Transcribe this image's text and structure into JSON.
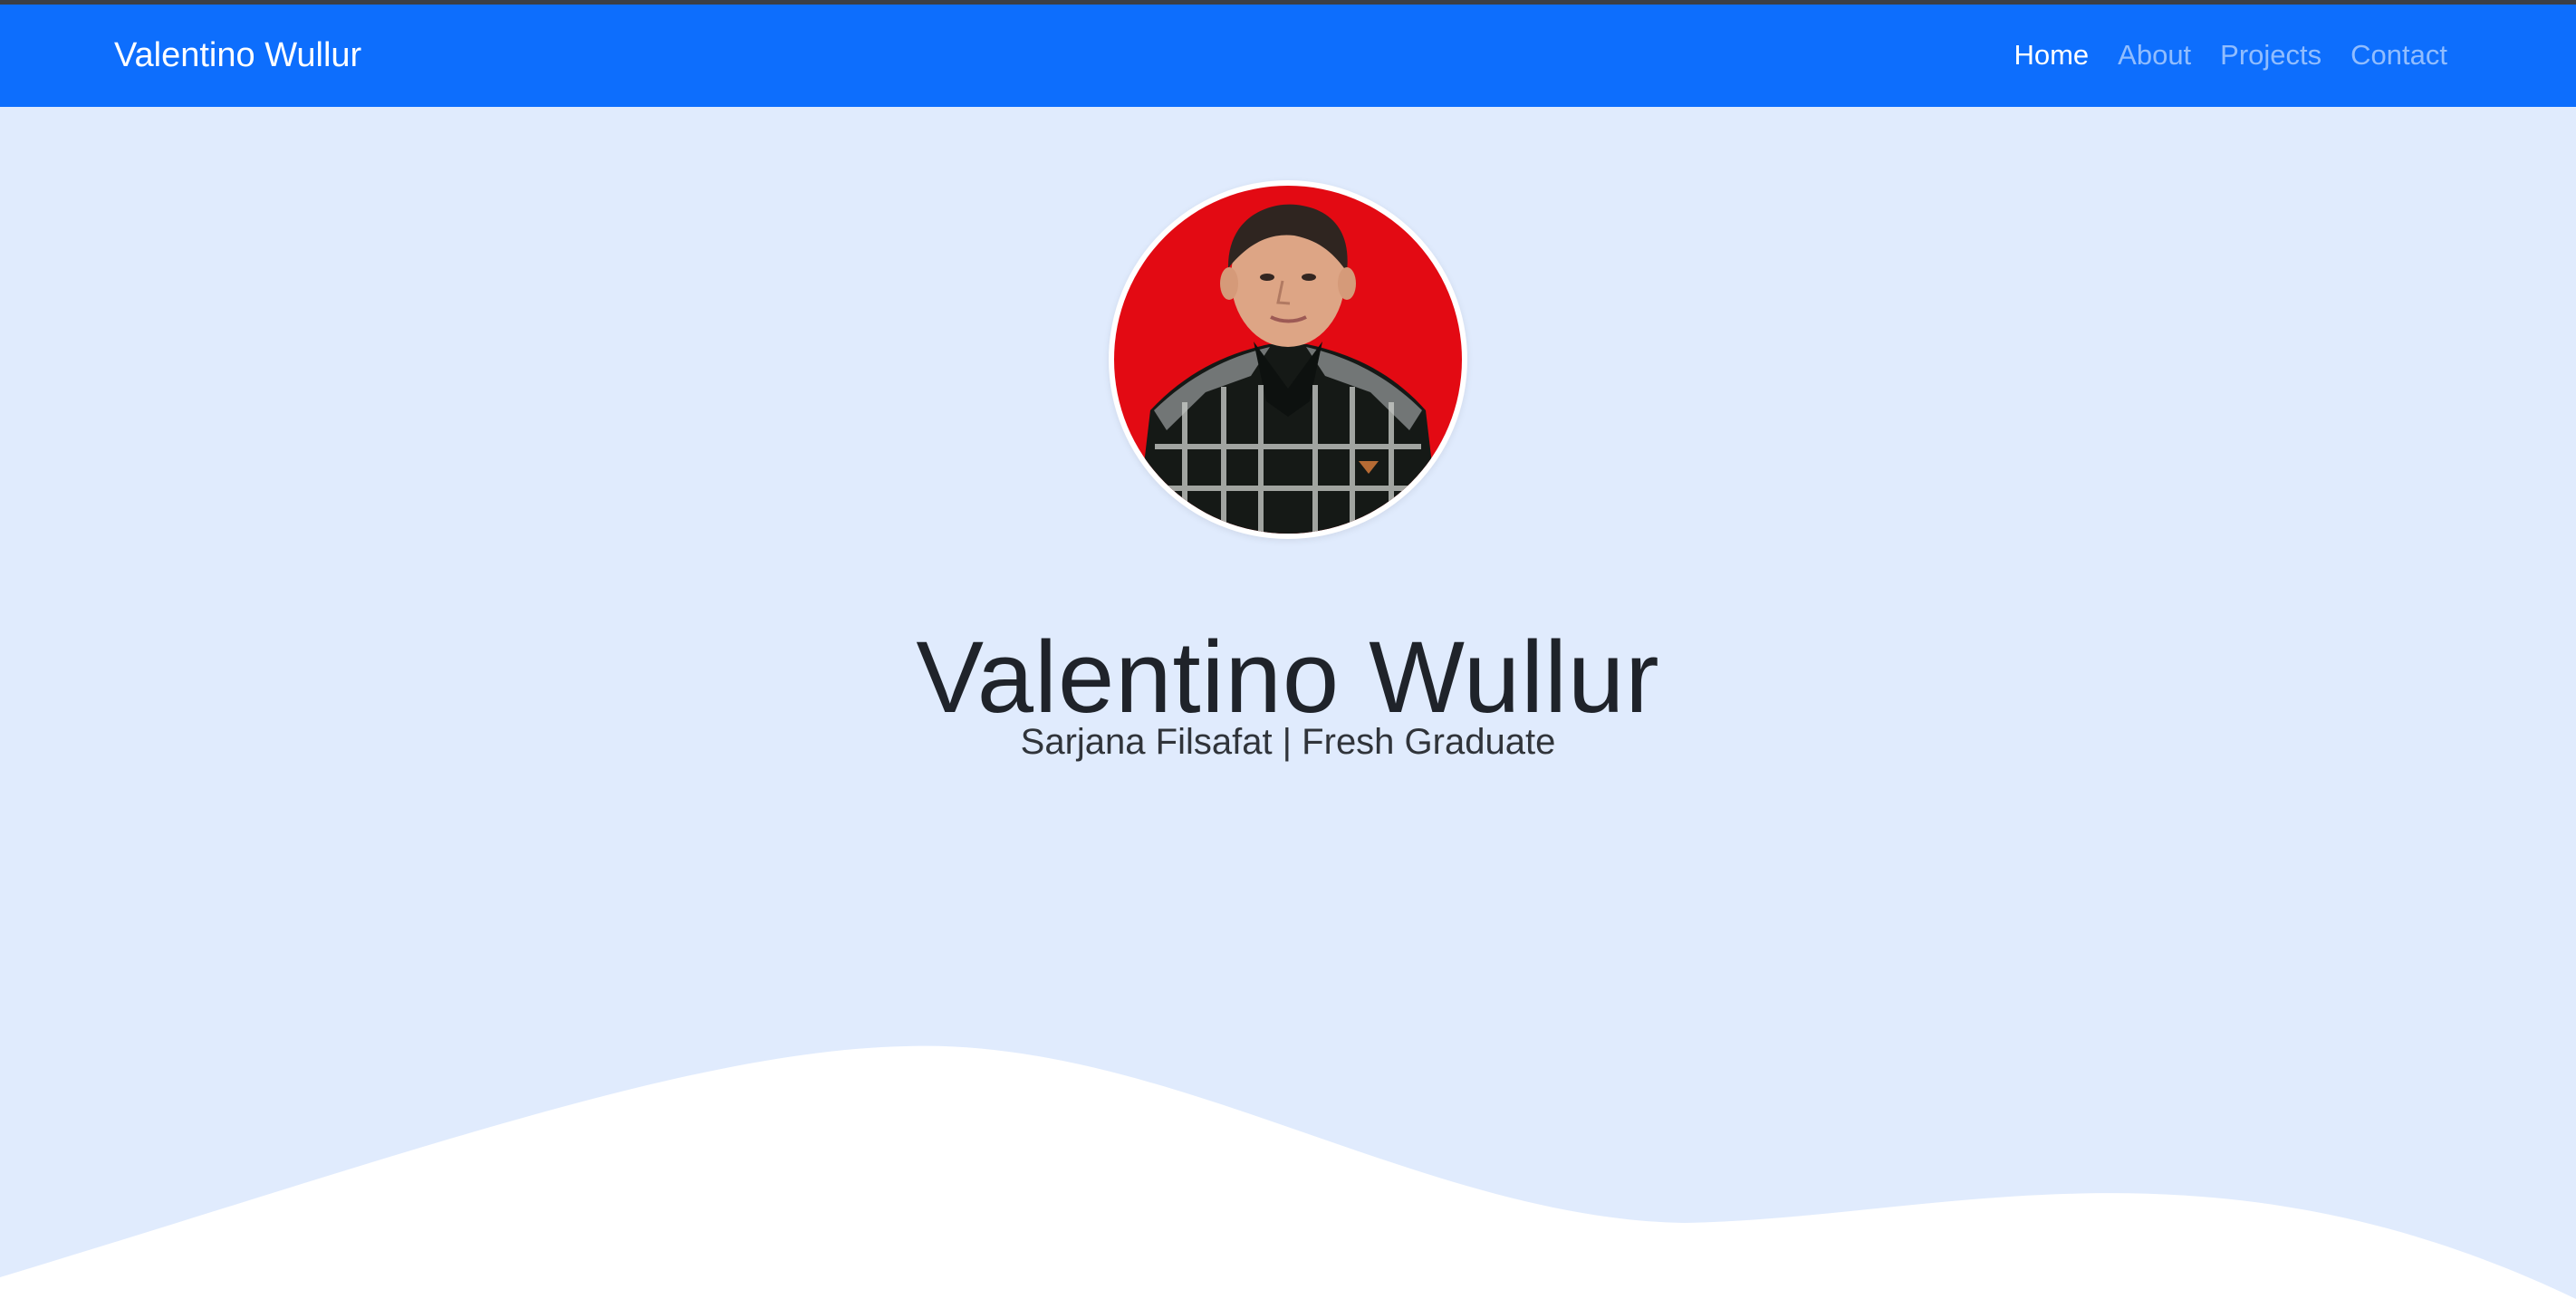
{
  "navbar": {
    "brand": "Valentino Wullur",
    "links": [
      {
        "label": "Home",
        "active": true
      },
      {
        "label": "About",
        "active": false
      },
      {
        "label": "Projects",
        "active": false
      },
      {
        "label": "Contact",
        "active": false
      }
    ]
  },
  "hero": {
    "name": "Valentino Wullur",
    "subtitle": "Sarjana Filsafat | Fresh Graduate",
    "photo_icon": "profile-photo"
  },
  "colors": {
    "navbar_bg": "#0d6efd",
    "hero_bg": "#e0ebfd",
    "wave": "#ffffff",
    "photo_background": "#e30a13"
  }
}
